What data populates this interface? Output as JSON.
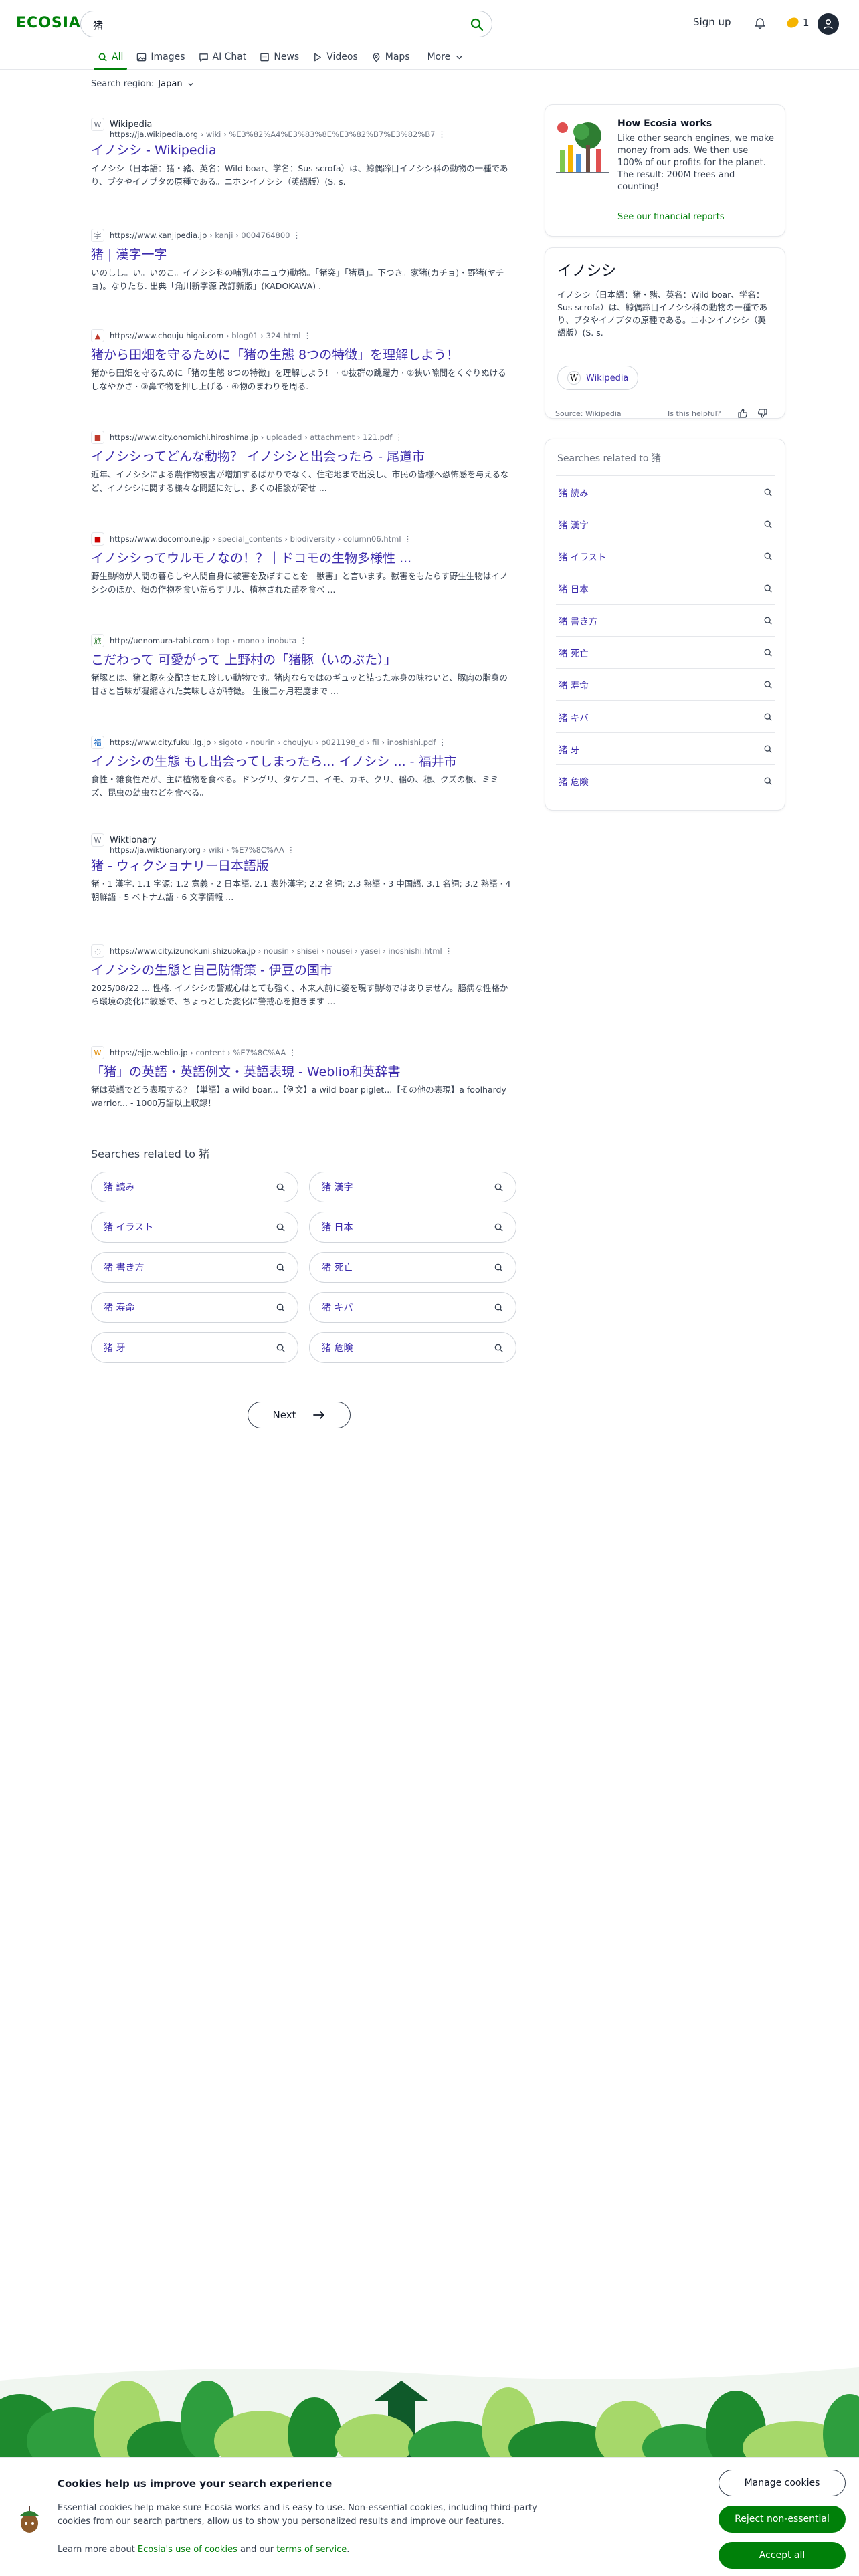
{
  "header": {
    "logo": "ECOSIA",
    "search_value": "猪",
    "signup": "Sign up",
    "seed_count": "1"
  },
  "tabs": [
    {
      "label": "All",
      "icon": "search-icon"
    },
    {
      "label": "Images",
      "icon": "image-icon"
    },
    {
      "label": "AI Chat",
      "icon": "chat-icon"
    },
    {
      "label": "News",
      "icon": "news-icon"
    },
    {
      "label": "Videos",
      "icon": "play-icon"
    },
    {
      "label": "Maps",
      "icon": "pin-icon"
    },
    {
      "label": "More",
      "icon": "chevron-down-icon"
    }
  ],
  "region": {
    "label": "Search region:",
    "value": "Japan"
  },
  "results": [
    {
      "site": "Wikipedia",
      "host": "https://ja.wikipedia.org",
      "path": " › wiki › %E3%82%A4%E3%83%8E%E3%82%B7%E3%82%B7",
      "favicon": "W",
      "title": "イノシシ - Wikipedia",
      "snippet": "イノシシ（日本語：猪・豬、英名：Wild boar、学名：Sus scrofa）は、鯨偶蹄目イノシシ科の動物の一種であり、ブタやイノブタの原種である。ニホンイノシシ（英語版）(S. s."
    },
    {
      "site": "",
      "host": "https://www.kanjipedia.jp",
      "path": " › kanji › 0004764800",
      "favicon": "字",
      "title": "猪 | 漢字一字",
      "snippet": "いのしし。い。いのこ。イノシシ科の哺乳(ホニュウ)動物。「猪突」「猪勇」。下つき。家猪(カチョ)・野猪(ヤチョ)。なりたち. 出典「角川新字源 改訂新版」(KADOKAWA) ."
    },
    {
      "site": "",
      "host": "https://www.chouju higai.com",
      "path": " › blog01 › 324.html",
      "favicon": "▲",
      "title": "猪から田畑を守るために「猪の生態 8つの特徴」を理解しよう！",
      "snippet": "猪から田畑を守るために「猪の生態 8つの特徴」を理解しよう！ · ①抜群の跳躍力 · ②狭い隙間をくぐりぬけるしなやかさ · ③鼻で物を押し上げる · ④物のまわりを周る."
    },
    {
      "site": "",
      "host": "https://www.city.onomichi.hiroshima.jp",
      "path": " › uploaded › attachment › 121.pdf",
      "favicon": "■",
      "title": "イノシシってどんな動物？ イノシシと出会ったら - 尾道市",
      "snippet": "近年、イノシシによる農作物被害が増加するばかりでなく、住宅地まで出没し、市民の皆様へ恐怖感を与えるなど、イノシシに関する様々な問題に対し、多くの相談が寄せ ..."
    },
    {
      "site": "",
      "host": "https://www.docomo.ne.jp",
      "path": " › special_contents › biodiversity › column06.html",
      "favicon": "■",
      "title": "イノシシってウルモノなの！？｜ドコモの生物多様性 ...",
      "snippet": "野生動物が人間の暮らしや人間自身に被害を及ぼすことを「獣害」と言います。獣害をもたらす野生生物はイノシシのほか、畑の作物を食い荒らすサル、植林された苗を食べ ..."
    },
    {
      "site": "",
      "host": "http://uenomura-tabi.com",
      "path": " › top › mono › inobuta",
      "favicon": "旅",
      "title": "こだわって 可愛がって 上野村の「猪豚（いのぶた）」",
      "snippet": "猪豚とは、猪と豚を交配させた珍しい動物です。猪肉ならではのギュッと詰った赤身の味わいと、豚肉の脂身の甘さと旨味が凝縮された美味しさが特徴。 生後三ヶ月程度まで ..."
    },
    {
      "site": "",
      "host": "https://www.city.fukui.lg.jp",
      "path": " › sigoto › nourin › choujyu › p021198_d › fil › inoshishi.pdf",
      "favicon": "福",
      "title": "イノシシの生態 もし出会ってしまったら... イノシシ ... - 福井市",
      "snippet": "食性・雑食性だが、主に植物を食べる。ドングリ、タケノコ、イモ、カキ、クリ、稲の、穂、クズの根、ミミズ、昆虫の幼虫などを食べる。"
    },
    {
      "site": "Wiktionary",
      "host": "https://ja.wiktionary.org",
      "path": " › wiki › %E7%8C%AA",
      "favicon": "W",
      "title": "猪 - ウィクショナリー日本語版",
      "snippet": "猪 · 1 漢字. 1.1 字源; 1.2 意義 · 2 日本語. 2.1 表外漢字; 2.2 名詞; 2.3 熟語 · 3 中国語. 3.1 名詞; 3.2 熟語 · 4 朝鮮語 · 5 ベトナム語 · 6 文字情報 ..."
    },
    {
      "site": "",
      "host": "https://www.city.izunokuni.shizuoka.jp",
      "path": " › nousin › shisei › nousei › yasei › inoshishi.html",
      "favicon": "◌",
      "title": "イノシシの生態と自己防衛策 - 伊豆の国市",
      "snippet": "2025/08/22 ... 性格. イノシシの警戒心はとても強く、本来人前に姿を現す動物ではありません。臆病な性格から環境の変化に敏感で、ちょっとした変化に警戒心を抱きます ..."
    },
    {
      "site": "",
      "host": "https://ejje.weblio.jp",
      "path": " › content › %E7%8C%AA",
      "favicon": "W",
      "title": "「猪」の英語・英語例文・英語表現 - Weblio和英辞書",
      "snippet": "猪は英語でどう表現する？【単語】a wild boar...【例文】a wild boar piglet...【その他の表現】a foolhardy warrior... - 1000万語以上収録！"
    }
  ],
  "related": {
    "heading": "Searches related to 猪",
    "items": [
      "猪 読み",
      "猪 漢字",
      "猪 イラスト",
      "猪 日本",
      "猪 書き方",
      "猪 死亡",
      "猪 寿命",
      "猪 キバ",
      "猪 牙",
      "猪 危険"
    ]
  },
  "next": "Next",
  "sidebar": {
    "how": {
      "title": "How Ecosia works",
      "text": "Like other search engines, we make money from ads. We then use 100% of our profits for the planet. The result: 200M trees and counting!",
      "link": "See our financial reports"
    },
    "entity": {
      "title": "イノシシ",
      "text": "イノシシ（日本語：猪・豬、英名：Wild boar、学名：Sus scrofa）は、鯨偶蹄目イノシシ科の動物の一種であり、ブタやイノブタの原種である。ニホンイノシシ（英語版）(S. s.",
      "wiki": "Wikipedia",
      "source": "Source: Wikipedia",
      "helpful": "Is this helpful?"
    },
    "related_title": "Searches related to 猪"
  },
  "cookie": {
    "title": "Cookies help us improve your search experience",
    "text": "Essential cookies help make sure Ecosia works and is easy to use. Non-essential cookies, including third-party cookies from our search partners, allow us to show you personalized results and improve our features.",
    "learn": "Learn more about ",
    "link1": "Ecosia's use of cookies",
    "and": " and our ",
    "link2": "terms of service",
    "period": ".",
    "manage": "Manage cookies",
    "reject": "Reject non-essential",
    "accept": "Accept all"
  },
  "colors": {
    "brand": "#008009",
    "link": "#3c2bac"
  }
}
